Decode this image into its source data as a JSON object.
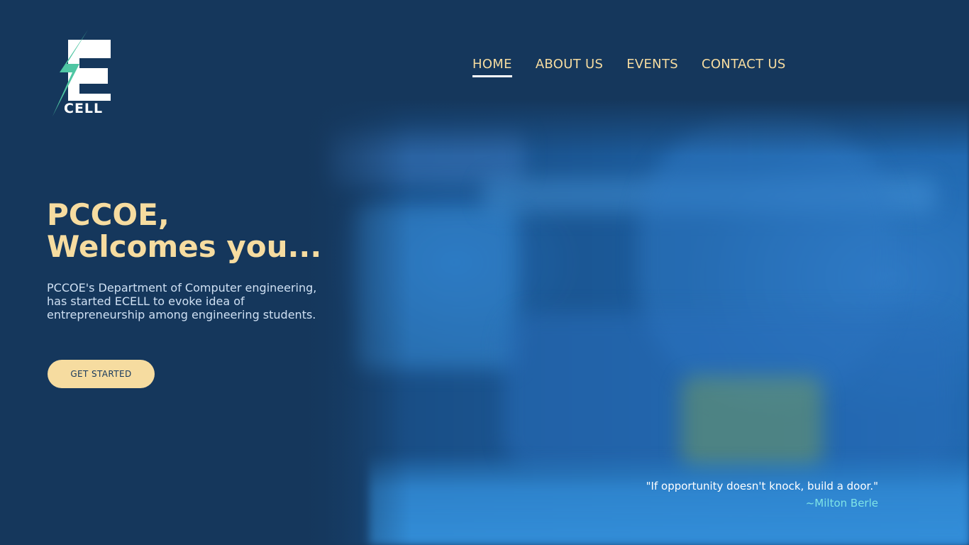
{
  "brand": {
    "logo_text": "CELL",
    "logo_letter": "E",
    "accent_color": "#4fc6a3",
    "cream_color": "#f6dca0",
    "background_color": "#15375c"
  },
  "nav": {
    "items": [
      {
        "label": "HOME",
        "active": true
      },
      {
        "label": "ABOUT US",
        "active": false
      },
      {
        "label": "EVENTS",
        "active": false
      },
      {
        "label": "CONTACT US",
        "active": false
      }
    ]
  },
  "hero": {
    "title_line1": "PCCOE,",
    "title_line2": "Welcomes you...",
    "description_line1": "PCCOE's Department of Computer engineering,",
    "description_line2": "has started ECELL to evoke idea of",
    "description_line3": "entrepreneurship among engineering students.",
    "cta_label": "GET STARTED"
  },
  "quote": {
    "text": "\"If opportunity doesn't knock, build a door.\"",
    "author": "~Milton Berle"
  }
}
